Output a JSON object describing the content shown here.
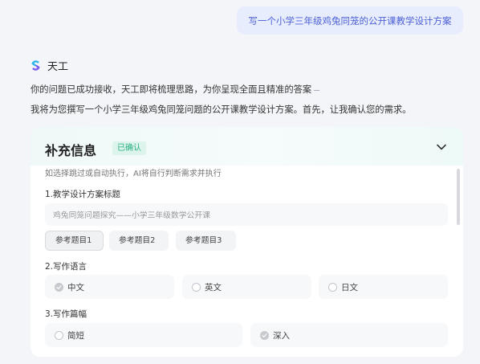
{
  "user_message": "写一个小学三年级鸡兔同笼的公开课教学设计方案",
  "assistant": {
    "name": "天工",
    "line1": "你的问题已成功接收，天工即将梳理思路，为你呈现全面且精准的答案",
    "line2": "我将为您撰写一个小学三年级鸡兔同笼问题的公开课教学设计方案。首先，让我确认您的需求。"
  },
  "card": {
    "title": "补充信息",
    "badge": "已确认",
    "hint": "如选择跳过或自动执行，AI将自行判断需求并执行",
    "q1_label": "1.教学设计方案标题",
    "q1_value": "鸡兔同笼问题探究——小学三年级数学公开课",
    "ref_buttons": [
      "参考题目1",
      "参考题目2",
      "参考题目3"
    ],
    "q2_label": "2.写作语言",
    "language_options": [
      "中文",
      "英文",
      "日文"
    ],
    "language_selected": "中文",
    "q3_label": "3.写作篇幅",
    "length_options": [
      "简短",
      "深入"
    ],
    "length_selected": "深入"
  },
  "colors": {
    "background": "#f3f5f9",
    "user_bubble": "#e7edfc",
    "user_text": "#4e62d6",
    "badge_bg": "#dcf4ec",
    "badge_text": "#27b07f"
  },
  "icons": [
    "tiangong-logo-icon",
    "chevron-down-icon",
    "radio-checked-icon",
    "radio-unchecked-icon"
  ]
}
